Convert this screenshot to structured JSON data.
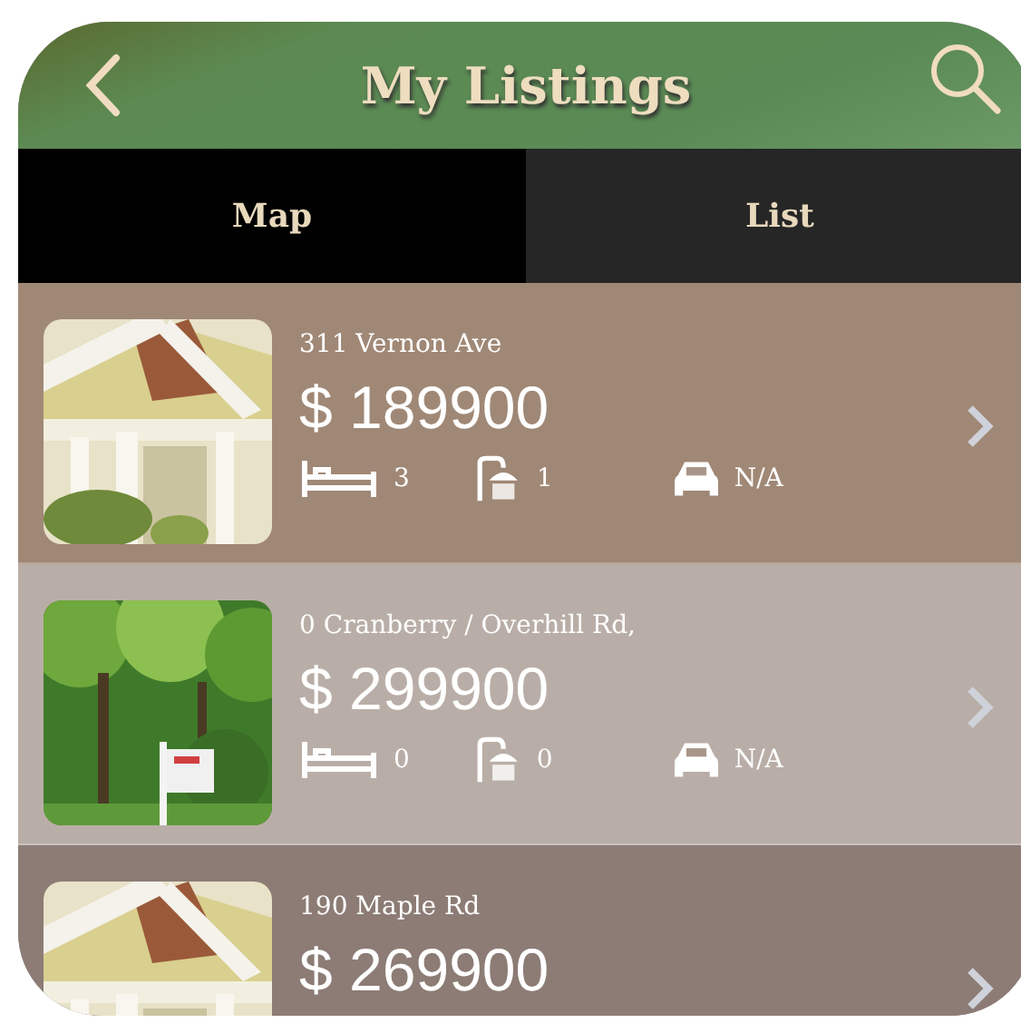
{
  "header": {
    "title": "My Listings"
  },
  "tabs": [
    {
      "label": "Map",
      "selected": false
    },
    {
      "label": "List",
      "selected": true
    }
  ],
  "listings": [
    {
      "kind": "house",
      "address": "311 Vernon Ave",
      "price": "$ 189900",
      "beds": "3",
      "baths": "1",
      "parking": "N/A",
      "color": "#a08876"
    },
    {
      "kind": "woods",
      "address": "0 Cranberry / Overhill Rd,",
      "price": "$ 299900",
      "beds": "0",
      "baths": "0",
      "parking": "N/A",
      "color": "#b9aea7"
    },
    {
      "kind": "house",
      "address": "190 Maple Rd",
      "price": "$ 269900",
      "color": "#8c7c75"
    }
  ]
}
